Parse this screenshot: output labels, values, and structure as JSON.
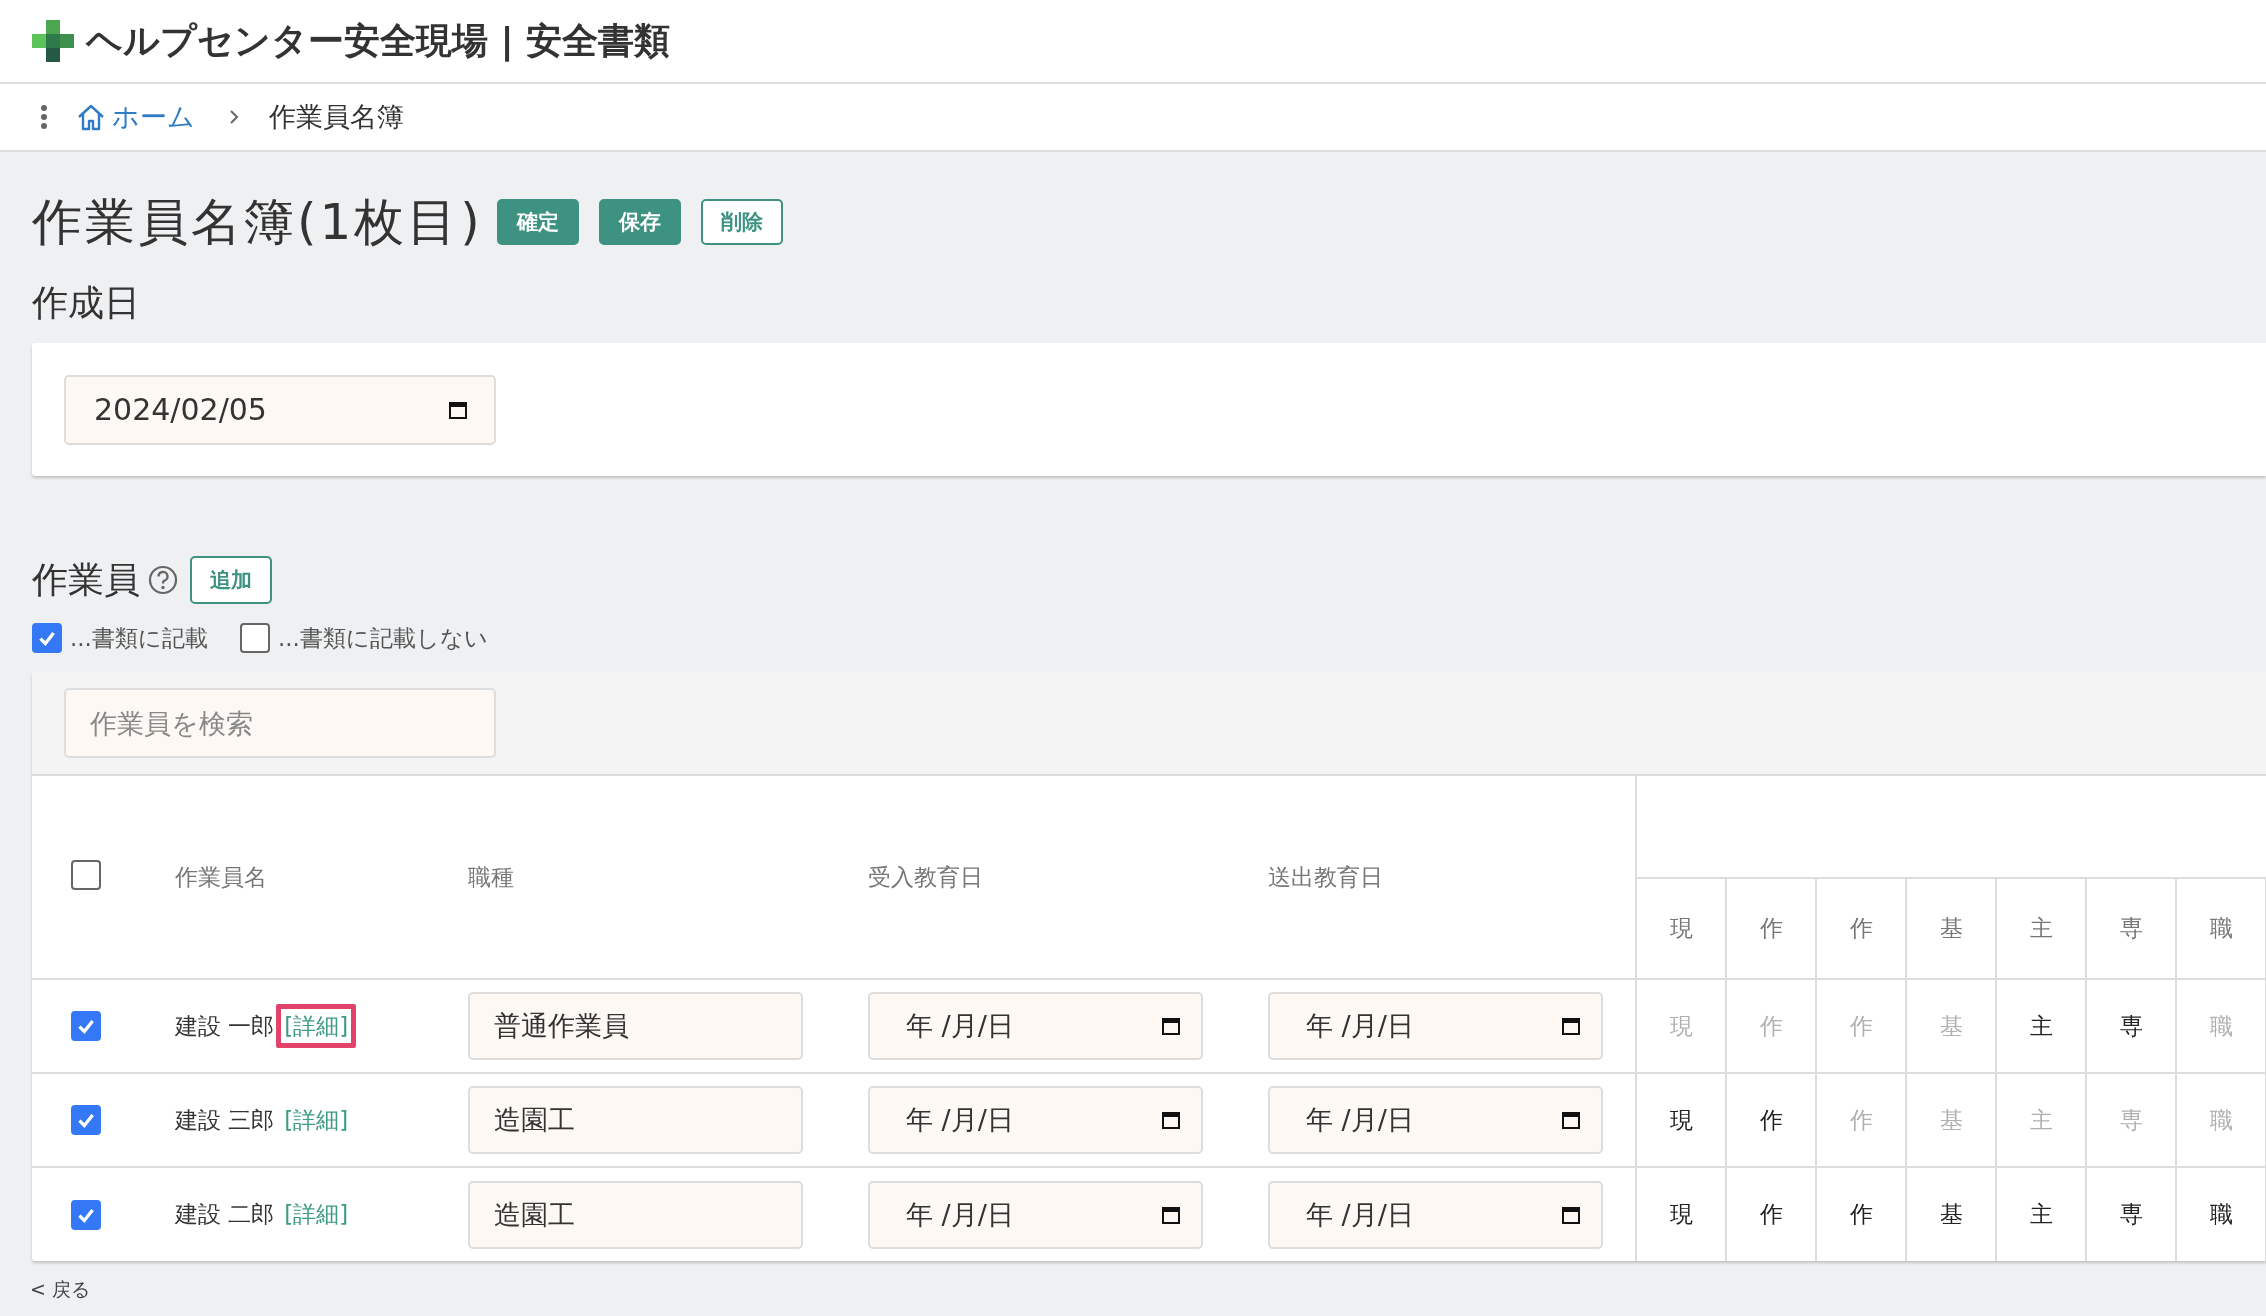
{
  "app_title": "ヘルプセンター安全現場 | 安全書類",
  "breadcrumb": [
    {
      "label": "ホーム",
      "kind": "link"
    },
    {
      "label": "作業員名簿",
      "kind": "current"
    }
  ],
  "page_title": "作業員名簿(1枚目)",
  "title_buttons": [
    {
      "label": "確定",
      "kind": "filled"
    },
    {
      "label": "保存",
      "kind": "filled"
    },
    {
      "label": "削除",
      "kind": "outline"
    }
  ],
  "created_date": {
    "label": "作成日",
    "value": "2024/02/05"
  },
  "workers": {
    "title": "作業員",
    "add_button": "追加",
    "filters": [
      {
        "label": "...書類に記載",
        "checked": true
      },
      {
        "label": "...書類に記載しない",
        "checked": false
      }
    ],
    "search": {
      "placeholder": "作業員を検索"
    },
    "header_checked": false,
    "columns": [
      "作業員名",
      "職種",
      "受入教育日",
      "送出教育日"
    ],
    "qualification_columns": [
      "現",
      "作",
      "作",
      "基",
      "主",
      "専",
      "職"
    ],
    "rows": [
      {
        "checked": true,
        "name": "建設 一郎",
        "detail": "[詳細]",
        "detail_outlined": true,
        "job": "普通作業員",
        "intake_date": "年 /月/日",
        "dispatch_date": "年 /月/日",
        "qualifications": [
          {
            "label": "現",
            "active": false
          },
          {
            "label": "作",
            "active": false
          },
          {
            "label": "作",
            "active": false
          },
          {
            "label": "基",
            "active": false
          },
          {
            "label": "主",
            "active": true
          },
          {
            "label": "専",
            "active": true
          },
          {
            "label": "職",
            "active": false
          }
        ]
      },
      {
        "checked": true,
        "name": "建設 三郎",
        "detail": "[詳細]",
        "detail_outlined": false,
        "job": "造園工",
        "intake_date": "年 /月/日",
        "dispatch_date": "年 /月/日",
        "qualifications": [
          {
            "label": "現",
            "active": true
          },
          {
            "label": "作",
            "active": true
          },
          {
            "label": "作",
            "active": false
          },
          {
            "label": "基",
            "active": false
          },
          {
            "label": "主",
            "active": false
          },
          {
            "label": "専",
            "active": false
          },
          {
            "label": "職",
            "active": false
          }
        ]
      },
      {
        "checked": true,
        "name": "建設 二郎",
        "detail": "[詳細]",
        "detail_outlined": false,
        "job": "造園工",
        "intake_date": "年 /月/日",
        "dispatch_date": "年 /月/日",
        "qualifications": [
          {
            "label": "現",
            "active": true
          },
          {
            "label": "作",
            "active": true
          },
          {
            "label": "作",
            "active": true
          },
          {
            "label": "基",
            "active": true
          },
          {
            "label": "主",
            "active": true
          },
          {
            "label": "専",
            "active": true
          },
          {
            "label": "職",
            "active": true
          }
        ]
      }
    ]
  },
  "back_link": "< 戻る"
}
